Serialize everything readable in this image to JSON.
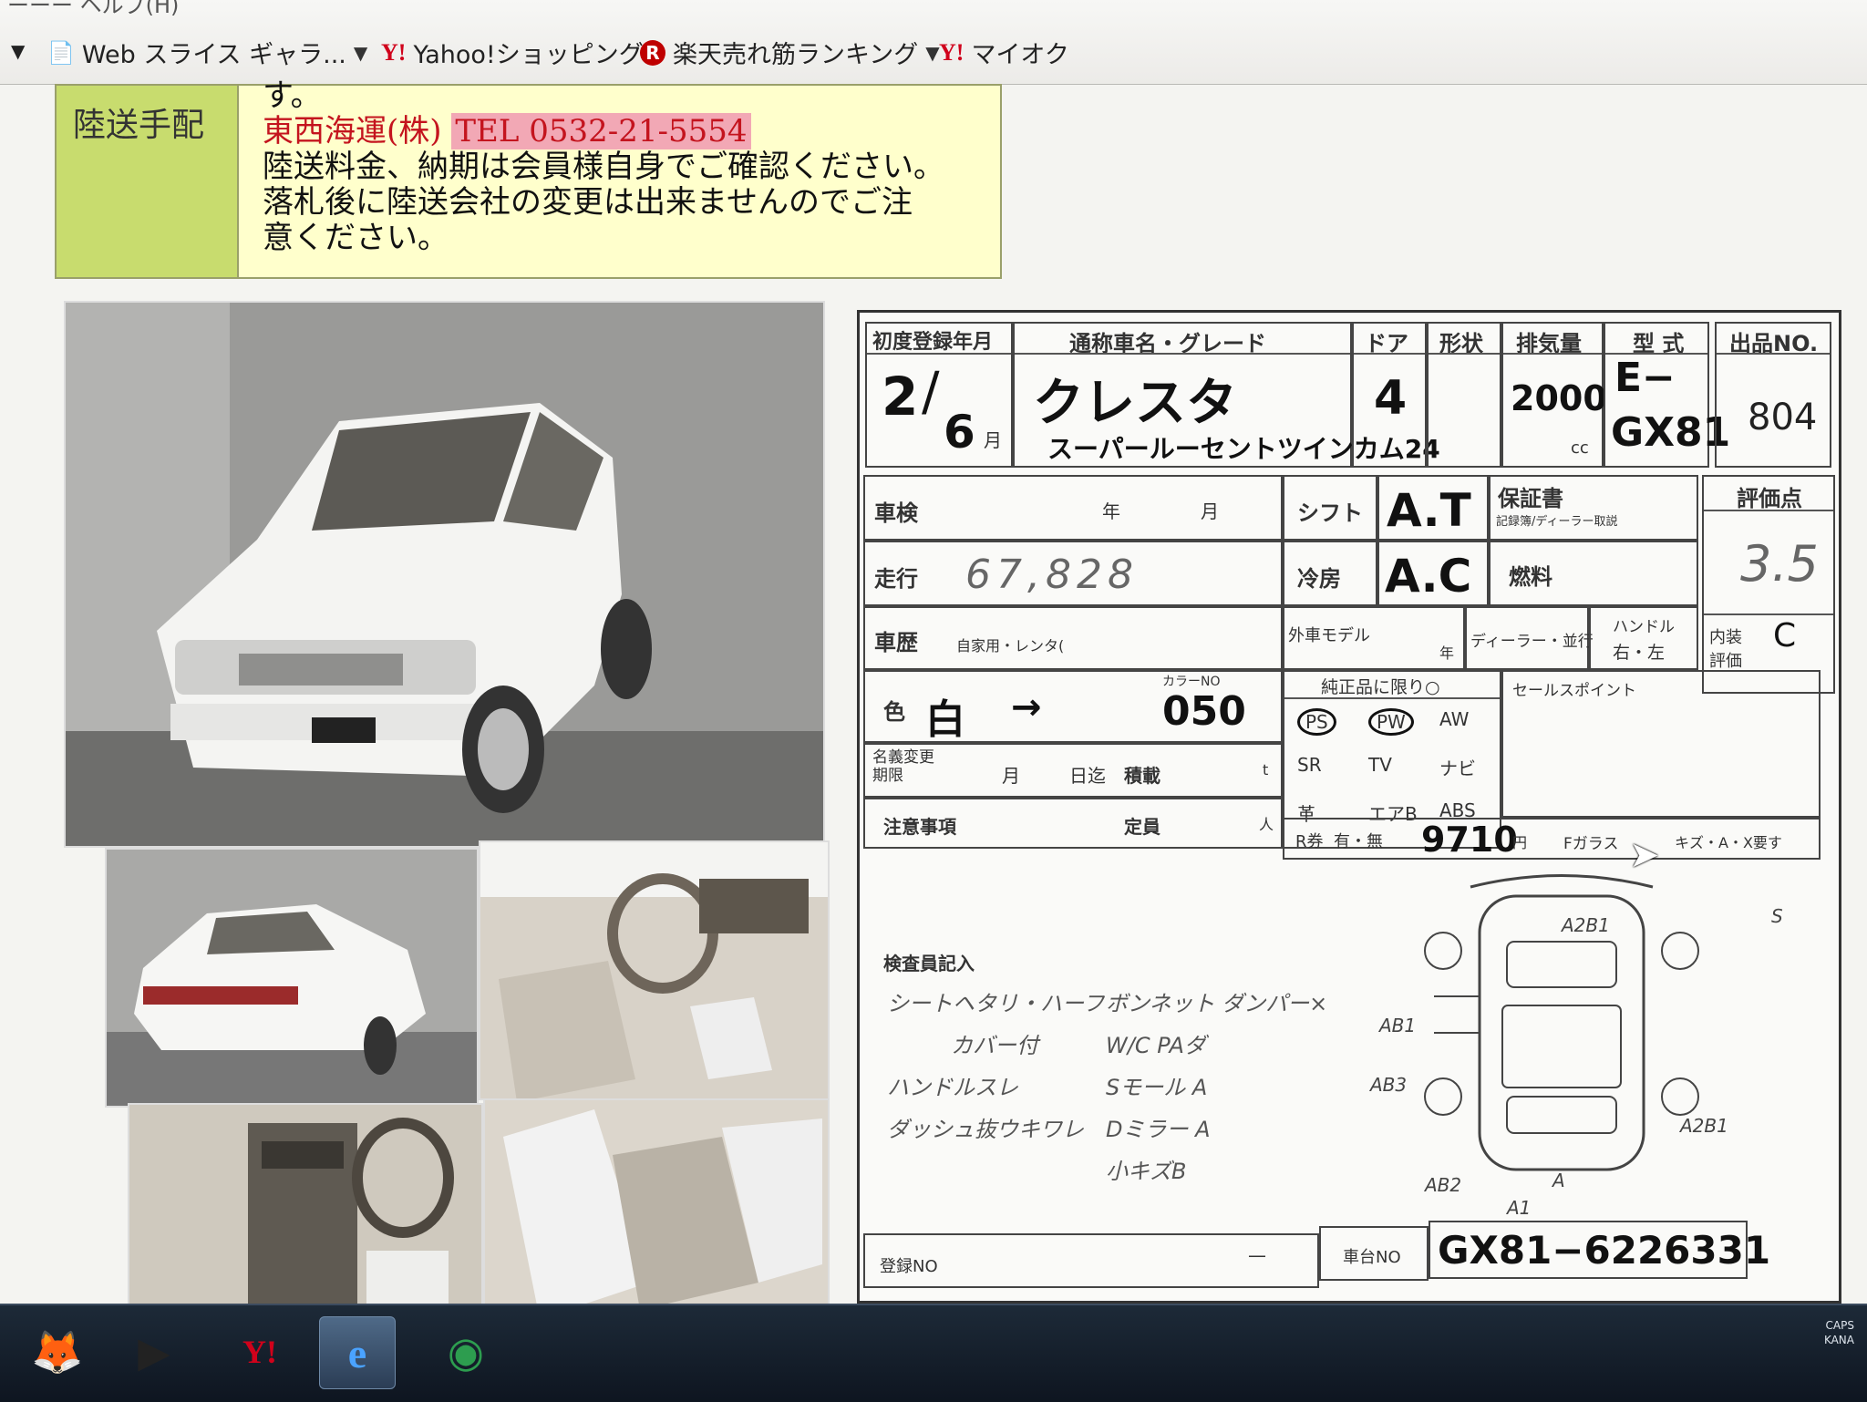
{
  "browser": {
    "favorites": [
      {
        "label": "Web スライス ギャラ...",
        "icon": "ie-page-icon",
        "dropdown": true
      },
      {
        "label": "Yahoo!ショッピング",
        "icon": "yahoo-icon",
        "dropdown": false
      },
      {
        "label": "楽天売れ筋ランキング",
        "icon": "rakuten-icon",
        "dropdown": true
      },
      {
        "label": "マイオク",
        "icon": "yahoo-icon",
        "dropdown": false
      }
    ]
  },
  "delivery": {
    "label": "陸送手配",
    "line0": "す。",
    "company": "東西海運(株)",
    "tel": "TEL 0532-21-5554",
    "note1": "陸送料金、納期は会員様自身でご確認ください。",
    "note2": "落札後に陸送会社の変更は出来ませんのでご注",
    "note3": "意ください。"
  },
  "sheet": {
    "headers": {
      "first_reg": "初度登録年月",
      "name_grade": "通称車名・グレード",
      "door": "ドア",
      "shape": "形状",
      "displacement": "排気量",
      "model": "型 式",
      "lot_no": "出品NO.",
      "inspection": "車検",
      "shift": "シフト",
      "warranty": "保証書",
      "warranty_sub": "記録簿/ディーラー取説",
      "score": "評価点",
      "mileage": "走行",
      "ac": "冷房",
      "fuel": "燃料",
      "history": "車歴",
      "history_sub": "自家用・レンタ(",
      "foreign": "外車モデル",
      "dealer": "ディーラー・並行",
      "handle": "ハンドル",
      "handle_sub": "右・左",
      "interior": "内装評価",
      "color": "色",
      "color_no": "カラーNO",
      "genuine": "純正品に限り○",
      "sales_point": "セールスポイント",
      "name_change": "名義変更期限",
      "load": "積載",
      "caution": "注意事項",
      "capacity": "定員",
      "inspector": "検査員記入",
      "reg_no": "登録NO",
      "chassis_label": "車台NO",
      "year_unit": "年",
      "month_unit": "月",
      "day_unit": "日迄",
      "cc": "cc",
      "yen": "円",
      "ton": "t",
      "person": "人",
      "fglass": "Fガラス",
      "fglass_opts": "キズ・A・X要す",
      "recycle": "R券",
      "recycle_opts": "有・無"
    },
    "equipment": [
      "PS",
      "PW",
      "AW",
      "SR",
      "TV",
      "ナビ",
      "革",
      "エアB",
      "ABS"
    ],
    "values": {
      "first_reg_year": "2",
      "first_reg_month": "6",
      "car_name": "クレスタ",
      "grade": "スーパールーセントツインカム24",
      "doors": "4",
      "displacement": "2000",
      "model_prefix": "E−",
      "model": "GX81",
      "lot_no": "804",
      "shift": "A.T",
      "ac": "A.C",
      "score": "3.5",
      "interior_score": "C",
      "mileage": "67,828",
      "color": "白",
      "color_arrow": "→",
      "color_no": "050",
      "recycle_fee": "9710",
      "chassis_no": "GX81−6226331",
      "reg_no_dash": "—"
    },
    "inspector_notes": [
      [
        "シートヘタリ・ハーフ",
        "ボンネット ダンパー×"
      ],
      [
        "カバー付",
        "W/C PAダ"
      ],
      [
        "ハンドルスレ",
        "Sモール A"
      ],
      [
        "ダッシュ抜ウキワレ",
        "Dミラー A"
      ],
      [
        "",
        "小キズB"
      ]
    ],
    "diagram_marks": [
      "A2B1",
      "S",
      "AB1",
      "AB3",
      "A2B1",
      "AB2",
      "A1",
      "A"
    ]
  },
  "taskbar": {
    "items": [
      "explorer-icon",
      "media-player-icon",
      "yahoo-icon",
      "ie-icon",
      "chrome-icon"
    ],
    "tray": {
      "caps": "CAPS",
      "kana": "KANA"
    }
  }
}
